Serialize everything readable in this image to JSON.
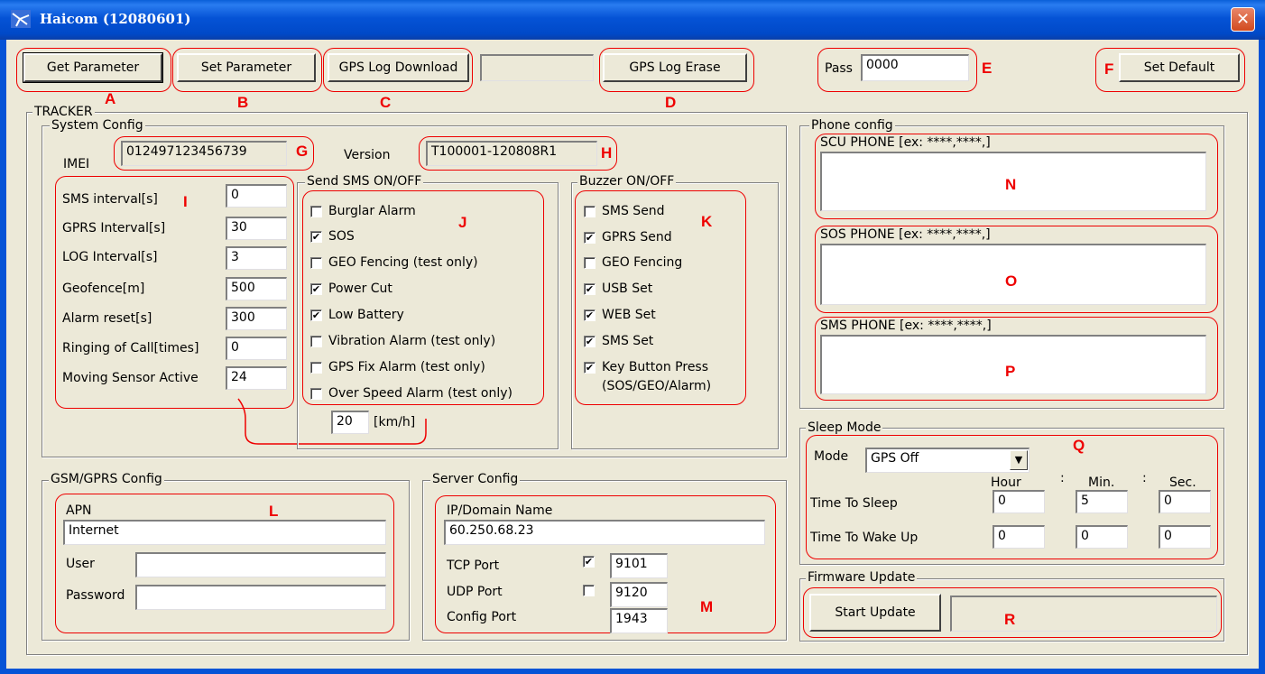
{
  "window": {
    "title": "Haicom (12080601)",
    "close": "✕"
  },
  "toolbar": {
    "get_param": "Get Parameter",
    "set_param": "Set Parameter",
    "gps_log_download": "GPS Log Download",
    "gps_log_erase": "GPS Log Erase",
    "pass_label": "Pass",
    "pass_value": "0000",
    "set_default": "Set Default"
  },
  "annotations": {
    "A": "A",
    "B": "B",
    "C": "C",
    "D": "D",
    "E": "E",
    "F": "F",
    "G": "G",
    "H": "H",
    "I": "I",
    "J": "J",
    "K": "K",
    "L": "L",
    "M": "M",
    "N": "N",
    "O": "O",
    "P": "P",
    "Q": "Q",
    "R": "R"
  },
  "tracker": {
    "title": "TRACKER",
    "system_config": {
      "title": "System Config",
      "imei_label": "IMEI",
      "imei_value": "012497123456739",
      "version_label": "Version",
      "version_value": "T100001-120808R1",
      "params": [
        {
          "label": "SMS interval[s]",
          "value": "0"
        },
        {
          "label": "GPRS Interval[s]",
          "value": "30"
        },
        {
          "label": "LOG Interval[s]",
          "value": "3"
        },
        {
          "label": "Geofence[m]",
          "value": "500"
        },
        {
          "label": "Alarm reset[s]",
          "value": "300"
        },
        {
          "label": "Ringing of Call[times]",
          "value": "0"
        },
        {
          "label": "Moving Sensor Active",
          "value": "24"
        }
      ],
      "send_sms": {
        "title": "Send SMS ON/OFF",
        "items": [
          {
            "label": "Burglar Alarm",
            "checked": false
          },
          {
            "label": "SOS",
            "checked": true
          },
          {
            "label": "GEO Fencing (test only)",
            "checked": false
          },
          {
            "label": "Power Cut",
            "checked": true
          },
          {
            "label": "Low Battery",
            "checked": true
          },
          {
            "label": "Vibration Alarm (test only)",
            "checked": false
          },
          {
            "label": "GPS Fix Alarm (test only)",
            "checked": false
          },
          {
            "label": "Over Speed Alarm (test only)",
            "checked": false
          }
        ],
        "speed_value": "20",
        "speed_unit": "[km/h]"
      },
      "buzzer": {
        "title": "Buzzer ON/OFF",
        "items": [
          {
            "label": "SMS Send",
            "checked": false
          },
          {
            "label": "GPRS Send",
            "checked": true
          },
          {
            "label": "GEO Fencing",
            "checked": false
          },
          {
            "label": "USB Set",
            "checked": true
          },
          {
            "label": "WEB Set",
            "checked": true
          },
          {
            "label": "SMS Set",
            "checked": true
          },
          {
            "label": "Key Button Press",
            "checked": true
          }
        ],
        "key_sub": "(SOS/GEO/Alarm)"
      }
    },
    "gsm": {
      "title": "GSM/GPRS Config",
      "apn_label": "APN",
      "apn_value": "Internet",
      "user_label": "User",
      "user_value": "",
      "password_label": "Password",
      "password_value": ""
    },
    "server": {
      "title": "Server Config",
      "ip_label": "IP/Domain Name",
      "ip_value": "60.250.68.23",
      "tcp_label": "TCP Port",
      "tcp_checked": true,
      "tcp_value": "9101",
      "udp_label": "UDP Port",
      "udp_checked": false,
      "udp_value": "9120",
      "config_label": "Config Port",
      "config_value": "1943"
    },
    "phone": {
      "title": "Phone config",
      "scu_label": "SCU PHONE [ex: ****,****,]",
      "sos_label": "SOS PHONE [ex: ****,****,]",
      "sms_label": "SMS PHONE [ex: ****,****,]"
    },
    "sleep": {
      "title": "Sleep Mode",
      "mode_label": "Mode",
      "mode_value": "GPS Off",
      "hour": "Hour",
      "min": "Min.",
      "sec": "Sec.",
      "colon": ":",
      "sleep_label": "Time To Sleep",
      "sleep_values": [
        "0",
        "5",
        "0"
      ],
      "wake_label": "Time To Wake Up",
      "wake_values": [
        "0",
        "0",
        "0"
      ]
    },
    "firmware": {
      "title": "Firmware Update",
      "start": "Start Update"
    }
  }
}
